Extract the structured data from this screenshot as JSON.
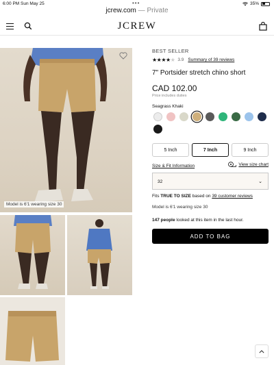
{
  "status_bar": {
    "time": "6:00 PM",
    "date": "Sun May 25",
    "dots": "•••",
    "battery": "35%"
  },
  "browser": {
    "domain": "jcrew.com",
    "separator": " — ",
    "mode": "Private"
  },
  "header": {
    "logo": "JCREW"
  },
  "gallery": {
    "model_caption": "Model is 6'1 wearing size 30"
  },
  "product": {
    "badge": "BEST SELLER",
    "rating_value": "3.9",
    "rating": 3.9,
    "reviews_link": "Summary of 39 reviews",
    "title": "7\" Portsider stretch chino short",
    "price": "CAD 102.00",
    "duties_note": "Price includes duties",
    "color_name": "Seagrass Khaki",
    "swatches": [
      {
        "color": "#ececec",
        "selected": false
      },
      {
        "color": "#f0c3c3",
        "selected": false
      },
      {
        "color": "#d9d8c9",
        "selected": false
      },
      {
        "color": "#cfb07c",
        "selected": true
      },
      {
        "color": "#5a5a5a",
        "selected": false
      },
      {
        "color": "#2fb57a",
        "selected": false
      },
      {
        "color": "#3a6a45",
        "selected": false
      },
      {
        "color": "#9cc4ec",
        "selected": false
      },
      {
        "color": "#1f2d4c",
        "selected": false
      },
      {
        "color": "#1a1a1a",
        "selected": false
      }
    ],
    "inseams": [
      {
        "label": "5 Inch",
        "selected": false
      },
      {
        "label": "7 Inch",
        "selected": true
      },
      {
        "label": "9 Inch",
        "selected": false
      }
    ],
    "fit_info_link": "Size & Fit Information",
    "size_chart_link": "View size chart",
    "selected_size": "32",
    "fits_prefix": "Fits ",
    "fits_true": "TRUE TO SIZE",
    "fits_mid": " based on ",
    "fits_reviews": "39 customer reviews",
    "model_wear": "Model is 6'1 wearing size 30",
    "looked_count": "147 people",
    "looked_text": " looked at this item in the last hour.",
    "add_to_bag": "ADD TO BAG"
  },
  "colors": {
    "accent": "#000000",
    "image_bg": "#ddd3c4"
  }
}
